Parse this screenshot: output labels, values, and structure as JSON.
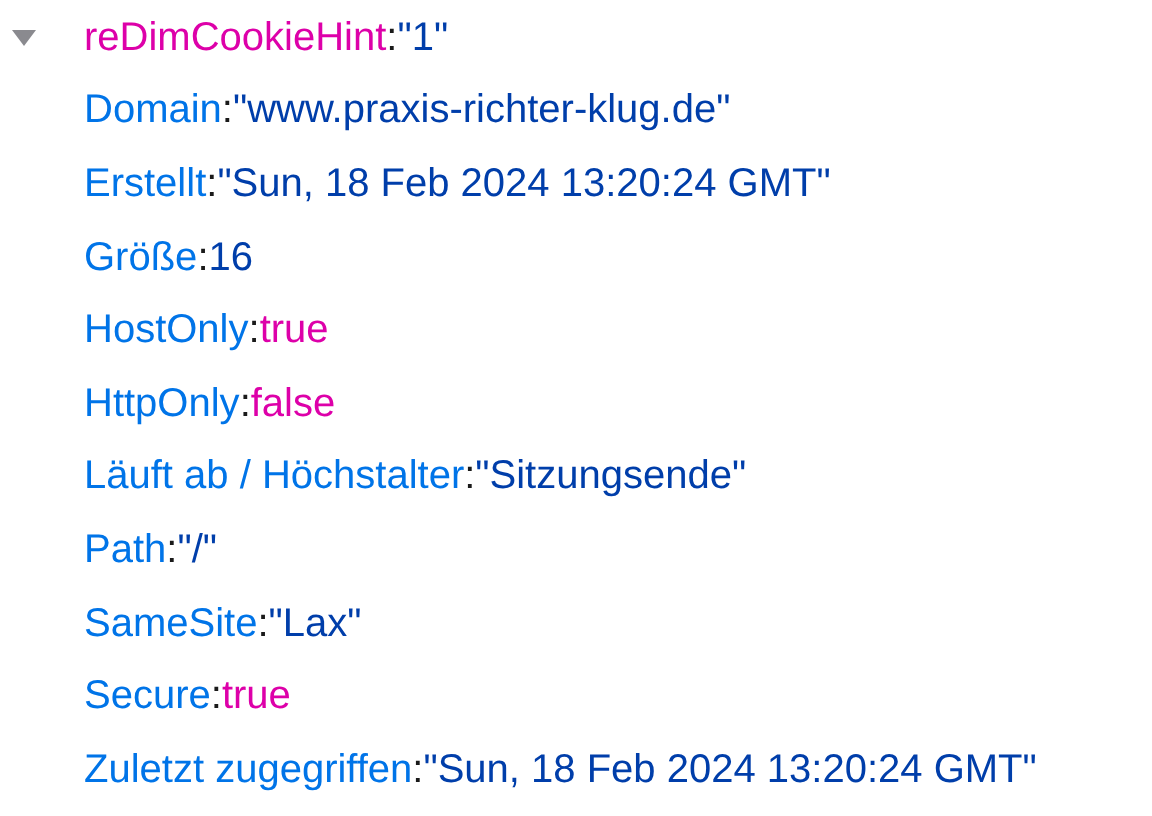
{
  "tree": {
    "key": "reDimCookieHint",
    "separator": ":",
    "value": "\"1\"",
    "kind": "string",
    "expanded": true,
    "children": [
      {
        "key": "Domain",
        "separator": ":",
        "value": "\"www.praxis-richter-klug.de\"",
        "kind": "string"
      },
      {
        "key": "Erstellt",
        "separator": ":",
        "value": "\"Sun, 18 Feb 2024 13:20:24 GMT\"",
        "kind": "string"
      },
      {
        "key": "Größe",
        "separator": ":",
        "value": "16",
        "kind": "number"
      },
      {
        "key": "HostOnly",
        "separator": ":",
        "value": "true",
        "kind": "boolean"
      },
      {
        "key": "HttpOnly",
        "separator": ":",
        "value": "false",
        "kind": "boolean"
      },
      {
        "key": "Läuft ab / Höchstalter",
        "separator": ":",
        "value": "\"Sitzungsende\"",
        "kind": "string"
      },
      {
        "key": "Path",
        "separator": ":",
        "value": "\"/\"",
        "kind": "string"
      },
      {
        "key": "SameSite",
        "separator": ":",
        "value": "\"Lax\"",
        "kind": "string"
      },
      {
        "key": "Secure",
        "separator": ":",
        "value": "true",
        "kind": "boolean"
      },
      {
        "key": "Zuletzt zugegriffen",
        "separator": ":",
        "value": "\"Sun, 18 Feb 2024 13:20:24 GMT\"",
        "kind": "string"
      }
    ]
  }
}
